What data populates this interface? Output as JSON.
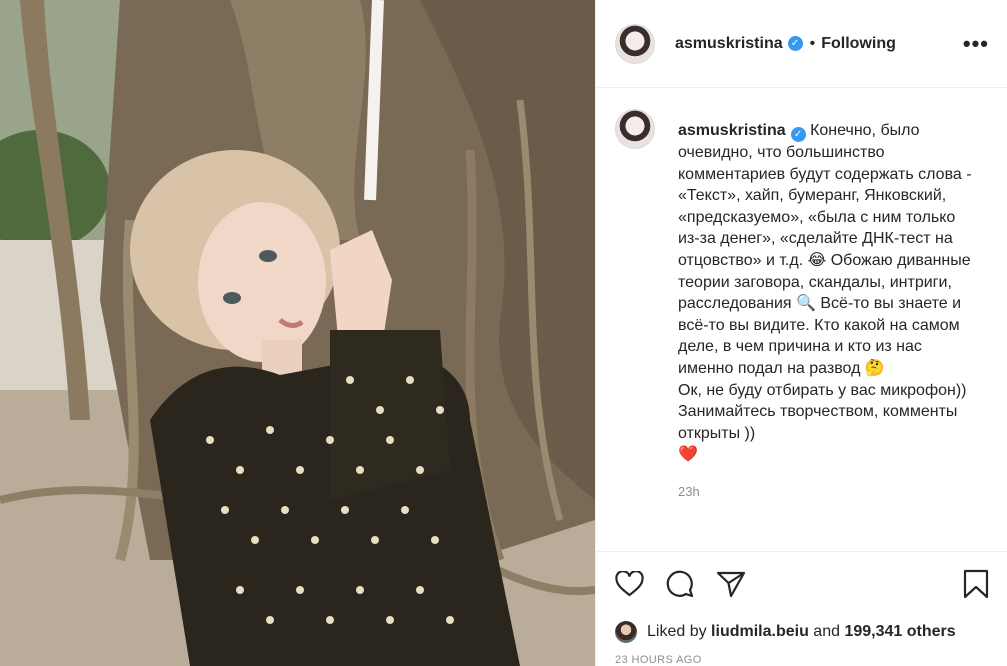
{
  "post": {
    "username": "asmuskristina",
    "follow_status": "Following",
    "more_label": "•••",
    "caption_text": "Конечно, было очевидно, что большинство комментариев будут содержать слова - «Текст», хайп, бумеранг, Янковский, «предсказуемо», «была с ним только из-за денег», «сделайте ДНК-тест на отцовство» и т.д. 😂 Обожаю диванные теории заговора, скандалы, интриги, расследования 🔍 Всё-то вы знаете и всё-то вы видите. Кто какой на самом деле, в чем причина и кто из нас именно подал на развод 🤔",
    "caption_text_2": "Ок, не буду отбирать у вас микрофон)) Занимайтесь творчеством, комменты открыты ))",
    "caption_emoji": "❤️",
    "comment_age": "23h",
    "liked_by_prefix": "Liked by",
    "liked_by_user": "liudmila.beiu",
    "liked_by_and": "and",
    "liked_by_others": "199,341 others",
    "posted_ago": "23 HOURS AGO"
  },
  "icons": {
    "verified": "verified-badge-icon",
    "like": "heart-icon",
    "comment": "comment-icon",
    "share": "send-icon",
    "save": "bookmark-icon"
  },
  "colors": {
    "verified_blue": "#3897f0",
    "meta_gray": "#8e8e8e",
    "text": "#262626"
  }
}
